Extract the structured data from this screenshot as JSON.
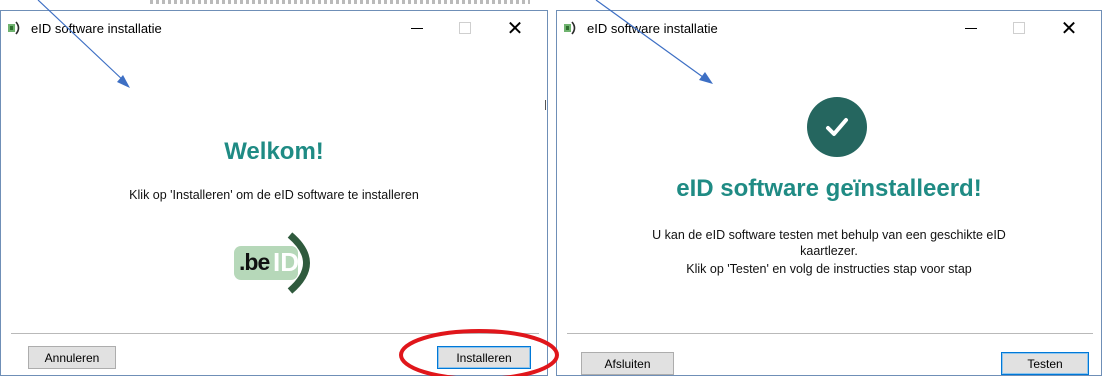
{
  "left_window": {
    "title": "eID software installatie",
    "heading": "Welkom!",
    "message": "Klik op 'Installeren' om de eID software te installeren",
    "logo_text_be": ".be",
    "logo_text_id": "ID",
    "cancel_label": "Annuleren",
    "install_label": "Installeren"
  },
  "right_window": {
    "title": "eID software installatie",
    "heading": "eID software geïnstalleerd!",
    "message_line1": "U kan de eID software testen met behulp van een geschikte eID",
    "message_line2": "kaartlezer.",
    "message_line3": "Klik op 'Testen' en volg de instructies stap voor stap",
    "close_label": "Afsluiten",
    "test_label": "Testen"
  },
  "colors": {
    "accent_teal": "#1f8b84",
    "check_circle": "#25665f",
    "annotation_arrow": "#3d6fc4",
    "annotation_circle": "#e0161b"
  },
  "icons": [
    "app-icon",
    "minimize-icon",
    "maximize-icon",
    "close-icon",
    "check-icon",
    "beid-logo"
  ]
}
